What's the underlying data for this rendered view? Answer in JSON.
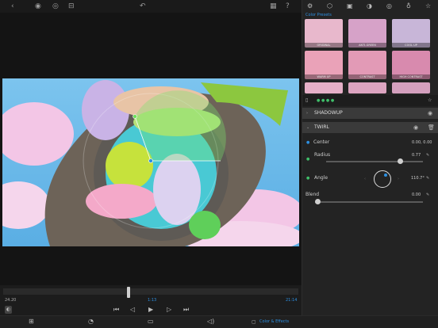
{
  "topbar": {
    "icons": [
      "back-icon",
      "eye-icon",
      "eye-icon",
      "compare-icon",
      "undo-icon",
      "film-icon",
      "help-icon"
    ]
  },
  "panel": {
    "tabs": [
      "adjust-tab",
      "cube-tab",
      "circle-tab",
      "target-tab",
      "bulb-tab",
      "star-tab"
    ],
    "presets_title": "Color Presets",
    "presets": [
      {
        "label": "ORIGINAL"
      },
      {
        "label": "ANTI-GREEN"
      },
      {
        "label": "COOL UP"
      },
      {
        "label": "WARM UP"
      },
      {
        "label": "CONTRAST"
      },
      {
        "label": "HIGH CONTRAST"
      }
    ],
    "layer_shadowup": "SHADOWUP",
    "layer_twirl": "TWIRL",
    "center_label": "Center",
    "center_value": "0.00, 0.00",
    "radius_label": "Radius",
    "radius_value": "0.77",
    "radius_level": 0.77,
    "angle_label": "Angle",
    "angle_value": "110.7°",
    "blend_label": "Blend",
    "blend_value": "0.00"
  },
  "timeline": {
    "start_time": "24.20",
    "current_time": "1:13",
    "end_time": "21:14"
  },
  "bottombar": {
    "color_effects_label": "Color & Effects"
  },
  "colors": {
    "accent": "#2d8fe0",
    "panel_bg": "#232323",
    "viewer_bg": "#141414"
  }
}
